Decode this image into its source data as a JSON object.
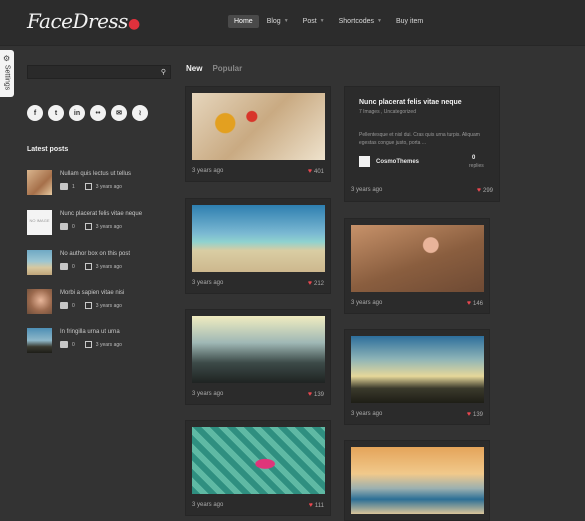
{
  "header": {
    "logo_text": "FaceDress",
    "nav": [
      {
        "label": "Home",
        "active": true,
        "has_caret": false
      },
      {
        "label": "Blog",
        "active": false,
        "has_caret": true
      },
      {
        "label": "Post",
        "active": false,
        "has_caret": true
      },
      {
        "label": "Shortcodes",
        "active": false,
        "has_caret": true
      },
      {
        "label": "Buy item",
        "active": false,
        "has_caret": false
      }
    ]
  },
  "settings_tab": {
    "label": "Settings",
    "icon": "gear-icon"
  },
  "sidebar": {
    "search": {
      "value": "",
      "placeholder": "",
      "icon": "search-icon"
    },
    "socials": [
      {
        "name": "facebook-icon",
        "glyph": "f"
      },
      {
        "name": "twitter-icon",
        "glyph": "t"
      },
      {
        "name": "linkedin-icon",
        "glyph": "in"
      },
      {
        "name": "flickr-icon",
        "glyph": "••"
      },
      {
        "name": "email-icon",
        "glyph": "✉"
      },
      {
        "name": "rss-icon",
        "glyph": "≀"
      }
    ],
    "latest_title": "Latest posts",
    "latest_posts": [
      {
        "title": "Nullam quis lectus ut tellus",
        "comments": "1",
        "date": "3 years ago",
        "thumb": "image"
      },
      {
        "title": "Nunc placerat felis vitae neque",
        "comments": "0",
        "date": "3 years ago",
        "thumb": "noimage",
        "thumb_text": "NO IMAGE"
      },
      {
        "title": "No author box on this post",
        "comments": "0",
        "date": "3 years ago",
        "thumb": "image"
      },
      {
        "title": "Morbi a sapien vitae nisi",
        "comments": "0",
        "date": "3 years ago",
        "thumb": "image"
      },
      {
        "title": "In fringilla urna ut urna",
        "comments": "0",
        "date": "3 years ago",
        "thumb": "image"
      }
    ]
  },
  "tabs": [
    {
      "label": "New",
      "active": true
    },
    {
      "label": "Popular",
      "active": false
    }
  ],
  "posts": [
    {
      "time": "3 years ago",
      "likes": "401"
    },
    {
      "time": "3 years ago",
      "likes": "212"
    },
    {
      "time": "3 years ago",
      "likes": "139"
    },
    {
      "time": "3 years ago",
      "likes": "111"
    },
    {
      "time": "3 years ago",
      "likes": "299"
    },
    {
      "time": "3 years ago",
      "likes": "146"
    },
    {
      "time": "3 years ago",
      "likes": "139"
    }
  ],
  "text_post": {
    "title": "Nunc placerat felis vitae neque",
    "subtitle": "7 Images , Uncategorized",
    "body": "Pellentesque et nisl dui. Cras quis urna turpis. Aliquam egestas congue justo, porta ...",
    "author": "CosmoThemes",
    "replies_count": "0",
    "replies_label": "replies"
  },
  "colors": {
    "background": "#333333",
    "accent_heart": "#e9474f",
    "logo_dot": "#e0313c"
  }
}
